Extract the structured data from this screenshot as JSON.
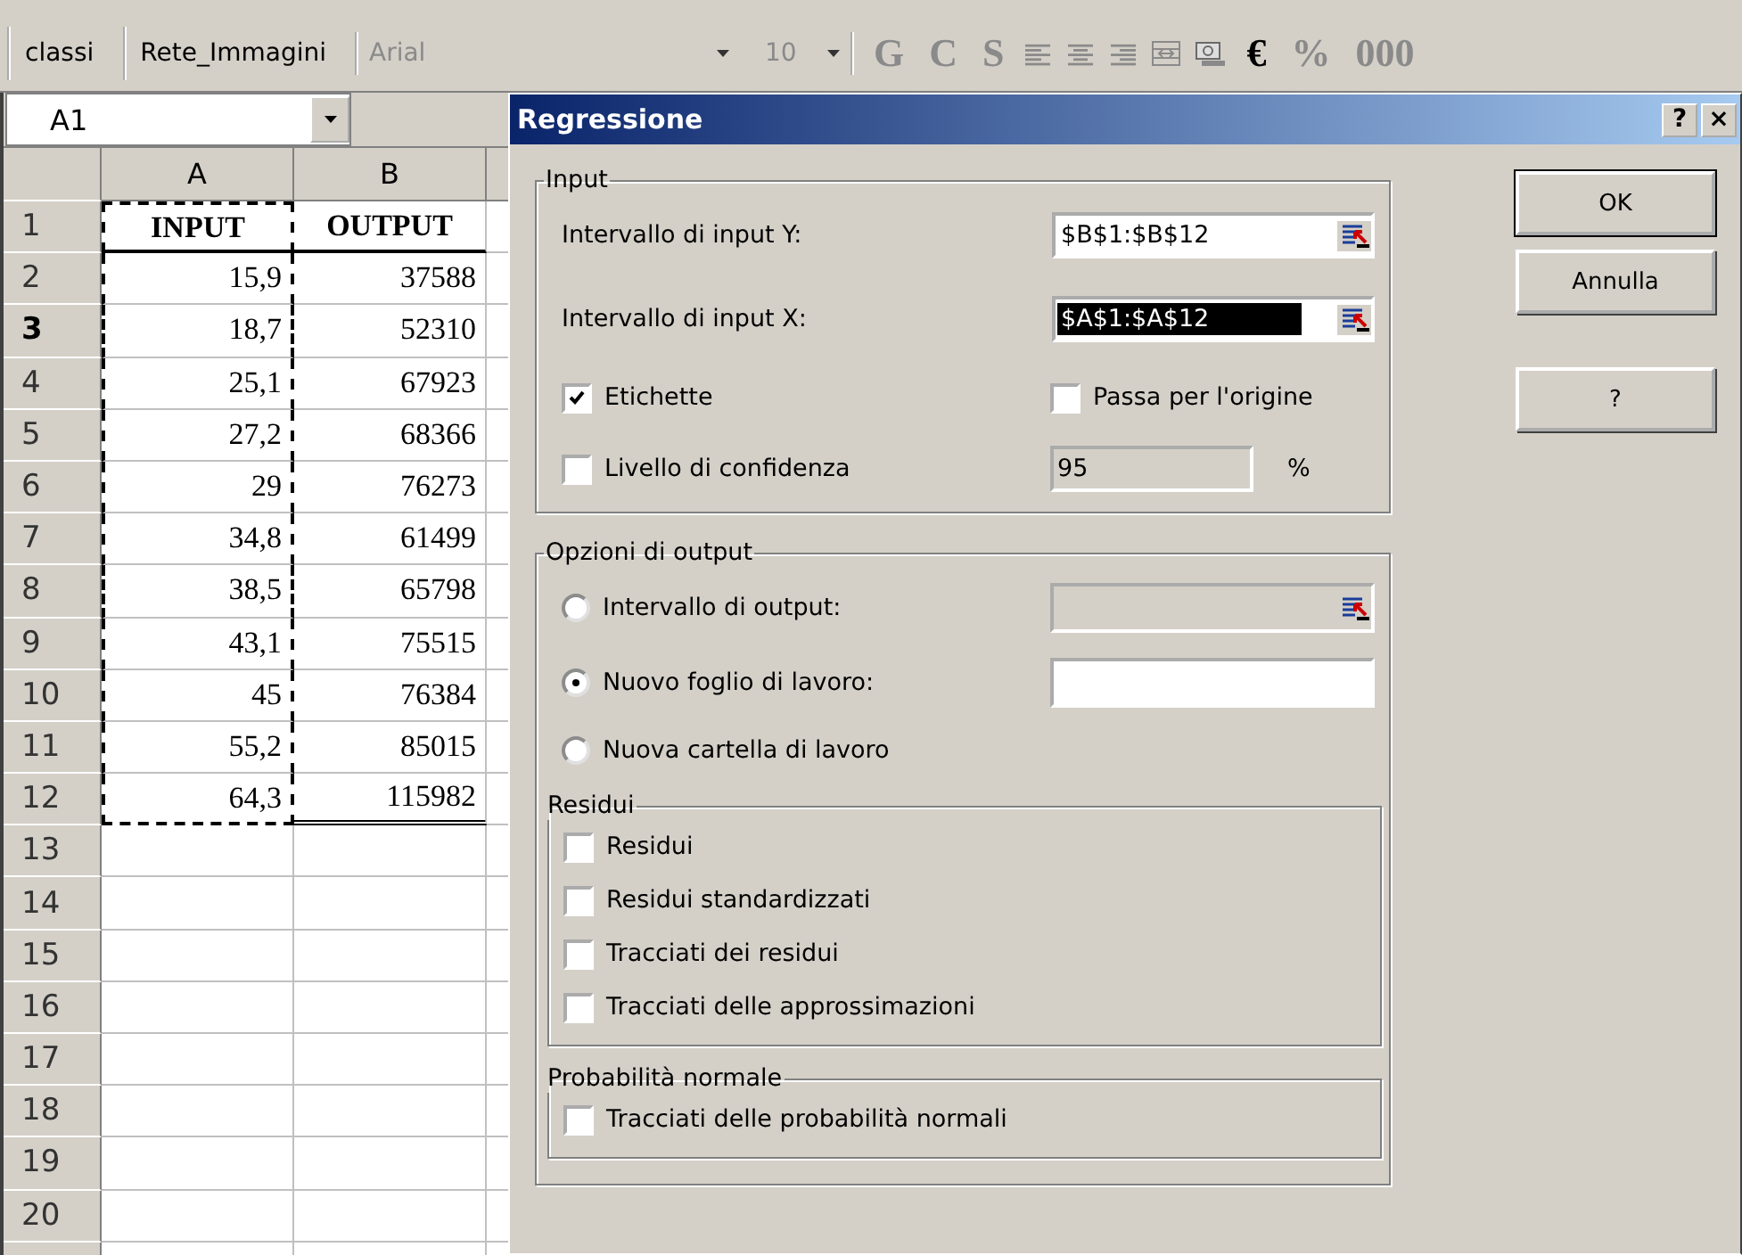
{
  "toolbar": {
    "items": [
      {
        "kind": "button",
        "label": "classi",
        "disabled": false
      },
      {
        "kind": "button",
        "label": "Rete_Immagini",
        "disabled": false
      },
      {
        "kind": "combo",
        "label": "Arial",
        "disabled": true
      },
      {
        "kind": "combo",
        "label": "10",
        "disabled": true
      },
      {
        "kind": "glyph",
        "label": "G",
        "disabled": true
      },
      {
        "kind": "glyph",
        "label": "C",
        "disabled": true
      },
      {
        "kind": "glyph",
        "label": "S",
        "disabled": true
      },
      {
        "kind": "align-left",
        "disabled": true
      },
      {
        "kind": "align-center",
        "disabled": true
      },
      {
        "kind": "align-right",
        "disabled": true
      },
      {
        "kind": "merge",
        "disabled": true
      },
      {
        "kind": "currency",
        "disabled": true
      },
      {
        "kind": "glyph",
        "label": "€",
        "disabled": false
      },
      {
        "kind": "glyph",
        "label": "%",
        "disabled": true
      },
      {
        "kind": "glyph",
        "label": "000",
        "disabled": true
      }
    ]
  },
  "sheet": {
    "name_box": "A1",
    "columns": [
      "A",
      "B"
    ],
    "rows": [
      {
        "number": "1",
        "highlighted": false,
        "kind": "header",
        "cells": [
          {
            "text": "INPUT",
            "marquee": true,
            "border_bottom": true
          },
          {
            "text": "OUTPUT",
            "marquee": false,
            "border_bottom": true
          }
        ]
      },
      {
        "number": "2",
        "highlighted": false,
        "kind": "data",
        "cells": [
          {
            "text": "15,9",
            "marquee": true,
            "border_bottom": false
          },
          {
            "text": "37588",
            "marquee": false,
            "border_bottom": false
          }
        ]
      },
      {
        "number": "3",
        "highlighted": true,
        "kind": "data",
        "cells": [
          {
            "text": "18,7",
            "marquee": true,
            "border_bottom": false
          },
          {
            "text": "52310",
            "marquee": false,
            "border_bottom": false
          }
        ]
      },
      {
        "number": "4",
        "highlighted": false,
        "kind": "data",
        "cells": [
          {
            "text": "25,1",
            "marquee": true,
            "border_bottom": false
          },
          {
            "text": "67923",
            "marquee": false,
            "border_bottom": false
          }
        ]
      },
      {
        "number": "5",
        "highlighted": false,
        "kind": "data",
        "cells": [
          {
            "text": "27,2",
            "marquee": true,
            "border_bottom": false
          },
          {
            "text": "68366",
            "marquee": false,
            "border_bottom": false
          }
        ]
      },
      {
        "number": "6",
        "highlighted": false,
        "kind": "data",
        "cells": [
          {
            "text": "29",
            "marquee": true,
            "border_bottom": false
          },
          {
            "text": "76273",
            "marquee": false,
            "border_bottom": false
          }
        ]
      },
      {
        "number": "7",
        "highlighted": false,
        "kind": "data",
        "cells": [
          {
            "text": "34,8",
            "marquee": true,
            "border_bottom": false
          },
          {
            "text": "61499",
            "marquee": false,
            "border_bottom": false
          }
        ]
      },
      {
        "number": "8",
        "highlighted": false,
        "kind": "data",
        "cells": [
          {
            "text": "38,5",
            "marquee": true,
            "border_bottom": false
          },
          {
            "text": "65798",
            "marquee": false,
            "border_bottom": false
          }
        ]
      },
      {
        "number": "9",
        "highlighted": false,
        "kind": "data",
        "cells": [
          {
            "text": "43,1",
            "marquee": true,
            "border_bottom": false
          },
          {
            "text": "75515",
            "marquee": false,
            "border_bottom": false
          }
        ]
      },
      {
        "number": "10",
        "highlighted": false,
        "kind": "data",
        "cells": [
          {
            "text": "45",
            "marquee": true,
            "border_bottom": false
          },
          {
            "text": "76384",
            "marquee": false,
            "border_bottom": false
          }
        ]
      },
      {
        "number": "11",
        "highlighted": false,
        "kind": "data",
        "cells": [
          {
            "text": "55,2",
            "marquee": true,
            "border_bottom": false
          },
          {
            "text": "85015",
            "marquee": false,
            "border_bottom": false
          }
        ]
      },
      {
        "number": "12",
        "highlighted": false,
        "kind": "data",
        "cells": [
          {
            "text": "64,3",
            "marquee": true,
            "border_bottom": false
          },
          {
            "text": "115982",
            "marquee": false,
            "border_bottom": true
          }
        ]
      },
      {
        "number": "13",
        "highlighted": false,
        "kind": "data"
      },
      {
        "number": "14",
        "highlighted": false,
        "kind": "data"
      },
      {
        "number": "15",
        "highlighted": false,
        "kind": "data"
      },
      {
        "number": "16",
        "highlighted": false,
        "kind": "data"
      },
      {
        "number": "17",
        "highlighted": false,
        "kind": "data"
      },
      {
        "number": "18",
        "highlighted": false,
        "kind": "data"
      },
      {
        "number": "19",
        "highlighted": false,
        "kind": "data"
      },
      {
        "number": "20",
        "highlighted": false,
        "kind": "data"
      }
    ]
  },
  "dialog": {
    "title": "Regressione",
    "title_buttons": [
      "?",
      "×"
    ],
    "input": {
      "title": "Input",
      "fields": [
        {
          "label": "Intervallo di input Y:",
          "value": "$B$1:$B$12",
          "selected": false
        },
        {
          "label": "Intervallo di input X:",
          "value": "$A$1:$A$12",
          "selected": true
        }
      ],
      "labels_checkbox": {
        "label": "Etichette",
        "checked": true
      },
      "origin_checkbox": {
        "label": "Passa per l'origine",
        "checked": false
      },
      "confidence": {
        "label": "Livello di confidenza",
        "checked": false,
        "value": "95",
        "unit": "%"
      }
    },
    "output": {
      "title": "Opzioni di output",
      "options": [
        {
          "label": "Intervallo di output:",
          "selected": false,
          "kind": "range"
        },
        {
          "label": "Nuovo foglio di lavoro:",
          "selected": true,
          "kind": "text"
        },
        {
          "label": "Nuova cartella di lavoro",
          "selected": false,
          "kind": "plain"
        }
      ],
      "residui": {
        "title": "Residui",
        "options": [
          {
            "label": "Residui",
            "checked": false
          },
          {
            "label": "Residui standardizzati",
            "checked": false
          },
          {
            "label": "Tracciati dei residui",
            "checked": false
          },
          {
            "label": "Tracciati delle approssimazioni",
            "checked": false
          }
        ]
      },
      "normal": {
        "title": "Probabilità normale",
        "options": [
          {
            "label": "Tracciati delle probabilità normali",
            "checked": false
          }
        ]
      }
    },
    "buttons": [
      {
        "label": "OK",
        "kind": "default"
      },
      {
        "label": "Annulla",
        "kind": "normal"
      },
      {
        "label": "?",
        "kind": "help"
      }
    ]
  }
}
